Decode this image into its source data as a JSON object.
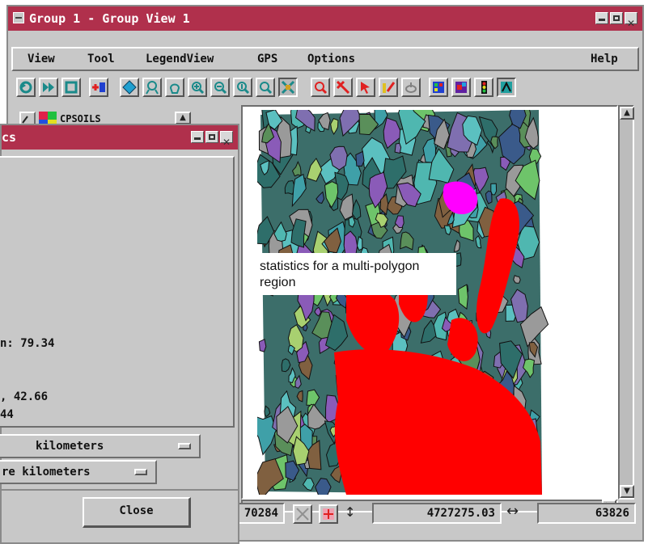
{
  "main_window": {
    "title": "Group 1 - Group View 1",
    "menu": [
      "View",
      "Tool",
      "LegendView",
      "GPS",
      "Options",
      "Help"
    ]
  },
  "layer": {
    "name": "CPSOILS"
  },
  "statusbar": {
    "field1": "70284",
    "field2": "4727275.03",
    "field3": "63826"
  },
  "stats_dialog": {
    "title_fragment": "cs",
    "line_a": "n: 79.34",
    "line_b": ", 42.66",
    "line_c": "44",
    "length_units": "kilometers",
    "area_units": "re kilometers",
    "close_label": "Close"
  },
  "annotation": {
    "text": "statistics for a multi-polygon region"
  },
  "colors": {
    "titlebar": "#b0304c",
    "window_bg": "#c8c8c8",
    "selection_red": "#ff0000",
    "selection_magenta": "#ff00ff"
  }
}
